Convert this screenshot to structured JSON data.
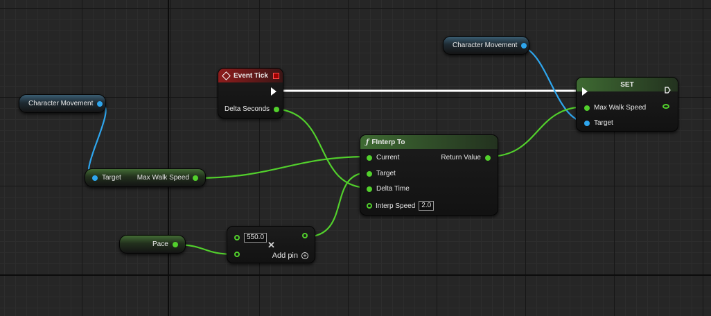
{
  "nodes": {
    "char_movement_left": {
      "label": "Character Movement"
    },
    "char_movement_top": {
      "label": "Character Movement"
    },
    "get_max_walk_speed": {
      "target_label": "Target",
      "output_label": "Max Walk Speed"
    },
    "event_tick": {
      "title": "Event Tick",
      "delta_label": "Delta Seconds"
    },
    "set_node": {
      "title": "SET",
      "max_walk_speed_label": "Max Walk Speed",
      "target_label": "Target"
    },
    "finterp_to": {
      "icon_glyph": "ƒ",
      "title": "FInterp To",
      "current_label": "Current",
      "target_label": "Target",
      "delta_time_label": "Delta Time",
      "interp_speed_label": "Interp Speed",
      "interp_speed_value": "2.0",
      "return_label": "Return Value"
    },
    "pace": {
      "label": "Pace"
    },
    "multiply": {
      "value": "550.0",
      "add_pin_label": "Add pin"
    }
  },
  "colors": {
    "float_pin": "#52d02c",
    "object_pin": "#2ea6ee",
    "exec_wire": "#ffffff",
    "event_header": "#8d1c1c",
    "function_header": "#3e6a32"
  },
  "icons": {
    "event": "diamond-icon",
    "breakpoint": "square-icon",
    "function": "function-f-icon",
    "remove": "x-icon",
    "add": "plus-circle-icon"
  }
}
